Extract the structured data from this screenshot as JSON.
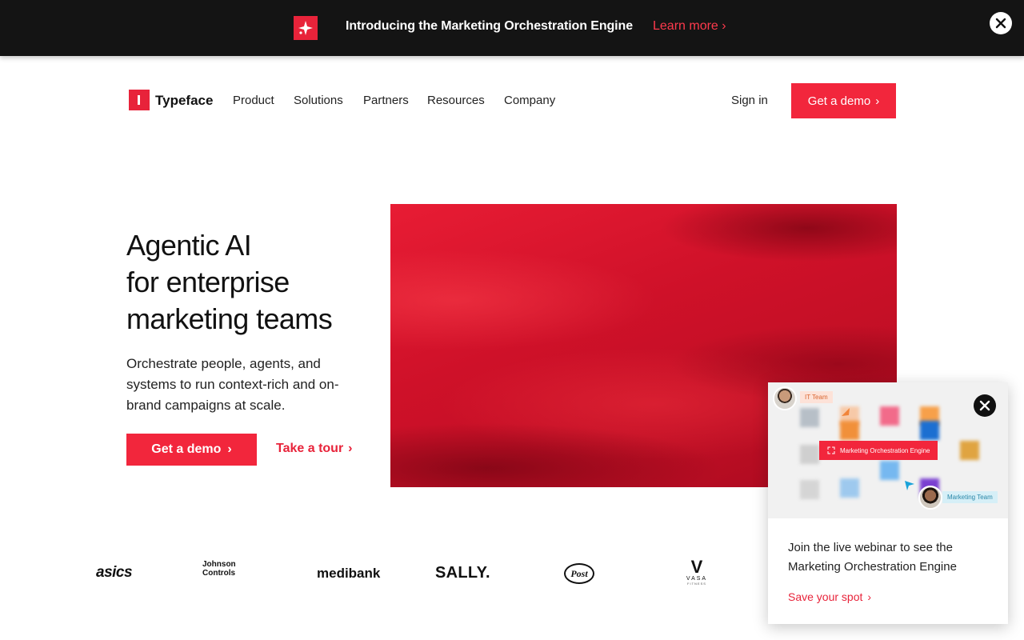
{
  "announcement": {
    "text": "Introducing the Marketing Orchestration Engine",
    "link": "Learn more"
  },
  "nav": {
    "brand": "Typeface",
    "items": [
      "Product",
      "Solutions",
      "Partners",
      "Resources",
      "Company"
    ],
    "signin": "Sign in",
    "demo": "Get a demo"
  },
  "hero": {
    "title_lines": [
      "Agentic AI",
      "for enterprise",
      "marketing teams"
    ],
    "subtitle": "Orchestrate people, agents, and systems to run context-rich and on-brand campaigns at scale.",
    "primary_cta": "Get a demo",
    "secondary_cta": "Take a tour"
  },
  "customer_logos": [
    "asics",
    "Johnson Controls",
    "medibank",
    "SALLY.",
    "Post",
    "VASA FITNESS"
  ],
  "logo_text": {
    "asics": "asics",
    "johnson": "Johnson",
    "controls": "Controls",
    "medibank": "medibank",
    "sally": "SALLY.",
    "post": "Post",
    "vasa_v": "V",
    "vasa_word": "VASA",
    "vasa_fitness": "FITNESS"
  },
  "webinar_popup": {
    "tag_it": "IT Team",
    "engine_label": "Marketing Orchestration Engine",
    "tag_marketing": "Marketing Team",
    "text": "Join the live webinar to see the Marketing Orchestration Engine",
    "link": "Save your spot"
  },
  "colors": {
    "accent": "#f2263c",
    "banner_bg": "#141414",
    "link_red": "#e8233a"
  }
}
